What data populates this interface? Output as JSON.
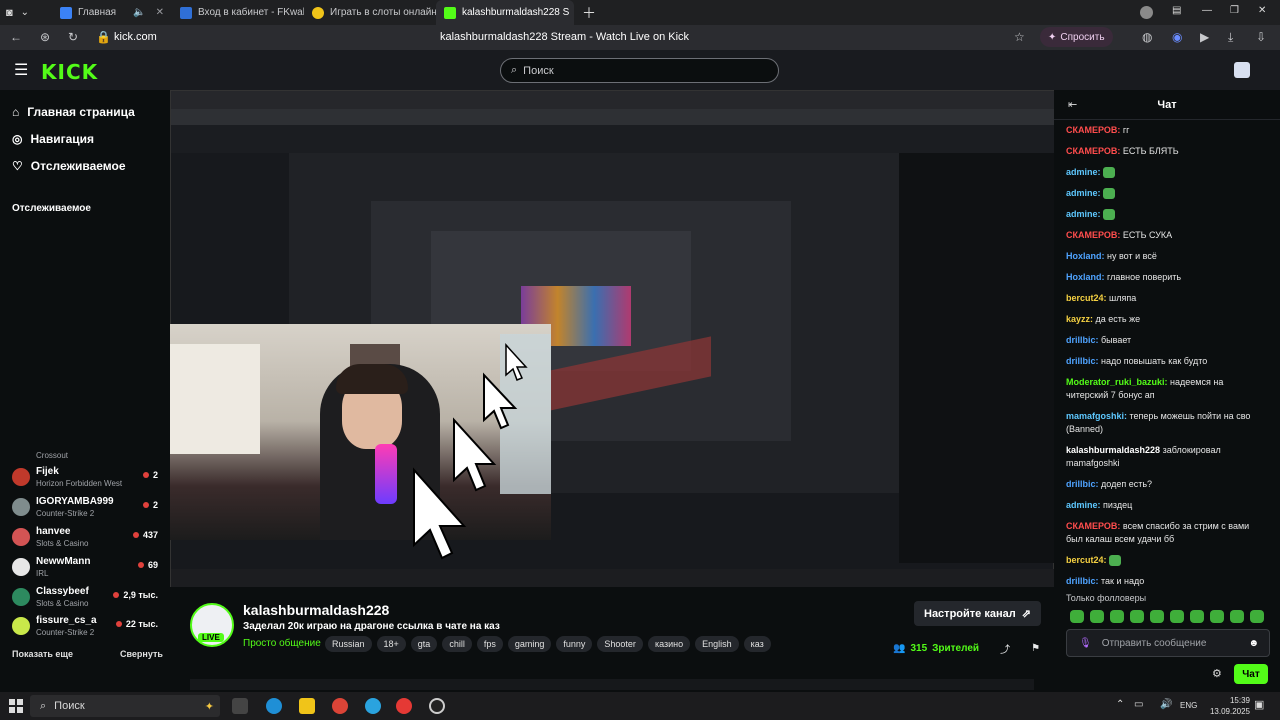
{
  "browser": {
    "tabs": [
      {
        "label": "Главная",
        "color": "#3b82f6"
      },
      {
        "label": "Вход в кабинет - FKwallet",
        "color": "#2f6fd6"
      },
      {
        "label": "Играть в слоты онлайн в",
        "color": "#f0c419"
      },
      {
        "label": "kalashburmaldash228 S",
        "color": "#53fc18"
      }
    ],
    "url": "kick.com",
    "page_title": "kalashburmaldash228 Stream - Watch Live on Kick",
    "ask_label": "Спросить"
  },
  "header": {
    "logo": "KICK",
    "search_placeholder": "Поиск"
  },
  "sidebar": {
    "nav": [
      {
        "label": "Главная страница",
        "icon": "home-icon"
      },
      {
        "label": "Навигация",
        "icon": "compass-icon"
      },
      {
        "label": "Отслеживаемое",
        "icon": "heart-icon"
      }
    ],
    "section_title": "Отслеживаемое",
    "partial_game": "Crossout",
    "following": [
      {
        "name": "Fijek",
        "game": "Horizon Forbidden West",
        "count": "2",
        "color": "#c0392b"
      },
      {
        "name": "IGORYAMBA999",
        "game": "Counter-Strike 2",
        "count": "2",
        "color": "#7f8c8d"
      },
      {
        "name": "hanvee",
        "game": "Slots & Casino",
        "count": "437",
        "color": "#d35454"
      },
      {
        "name": "NewwMann",
        "game": "IRL",
        "count": "69",
        "color": "#e7e7e7"
      },
      {
        "name": "Classybeef",
        "game": "Slots & Casino",
        "count": "2,9 тыс.",
        "color": "#2d8a5f"
      },
      {
        "name": "fissure_cs_a",
        "game": "Counter-Strike 2",
        "count": "22 тыс.",
        "color": "#c9e84a"
      }
    ],
    "show_more": "Показать еще",
    "collapse": "Свернуть"
  },
  "stream": {
    "streamer": "kalashburmaldash228",
    "live_badge": "LIVE",
    "title": "Заделал 20к играю на драгоне ссылка в чате на каз",
    "category": "Просто общение",
    "tags": [
      "Russian",
      "18+",
      "gta",
      "chill",
      "fps",
      "gaming",
      "funny",
      "Shooter",
      "казино",
      "English",
      "каз"
    ],
    "setup_button": "Настройте канал",
    "viewer_count": "315",
    "viewers_label": "Зрителей"
  },
  "chat": {
    "title": "Чат",
    "messages": [
      {
        "user": "СКАМЕРОВ:",
        "text": "гг",
        "color": "#ff4d4d"
      },
      {
        "user": "СКАМЕРОВ:",
        "text": "ЕСТЬ БЛЯТЬ",
        "color": "#ff4d4d"
      },
      {
        "user": "admine:",
        "text": "",
        "color": "#5ec8ff",
        "emote": true
      },
      {
        "user": "admine:",
        "text": "",
        "color": "#5ec8ff",
        "emote": true
      },
      {
        "user": "admine:",
        "text": "",
        "color": "#5ec8ff",
        "emote": true
      },
      {
        "user": "СКАМЕРОВ:",
        "text": "ЕСТЬ СУКА",
        "color": "#ff4d4d"
      },
      {
        "user": "Hoxland:",
        "text": "ну вот и всё",
        "color": "#4fa3ff"
      },
      {
        "user": "Hoxland:",
        "text": "главное поверить",
        "color": "#4fa3ff"
      },
      {
        "user": "bercut24:",
        "text": "шляпа",
        "color": "#f5d142"
      },
      {
        "user": "kayzz:",
        "text": "да есть же",
        "color": "#f5d142"
      },
      {
        "user": "drillbic:",
        "text": "бывает",
        "color": "#4fa3ff"
      },
      {
        "user": "drillbic:",
        "text": "надо повышать как будто",
        "color": "#4fa3ff"
      },
      {
        "user": "Moderator_ruki_bazuki:",
        "text": "надеемся на читерский 7 бонус ап",
        "color": "#53fc18"
      },
      {
        "user": "mamafgoshki:",
        "text": "теперь можешь пойти на сво (Banned)",
        "color": "#5ec8ff"
      },
      {
        "user": "kalashburmaldash228",
        "text": "заблокировал mamafgoshki",
        "color": "#ffffff"
      },
      {
        "user": "drillbic:",
        "text": "додеп есть?",
        "color": "#4fa3ff"
      },
      {
        "user": "admine:",
        "text": "пиздец",
        "color": "#5ec8ff"
      },
      {
        "user": "СКАМЕРОВ:",
        "text": "всем спасибо за стрим с вами был калаш всем удачи бб",
        "color": "#ff4d4d"
      },
      {
        "user": "bercut24:",
        "text": "",
        "color": "#f5d142",
        "emote": true
      },
      {
        "user": "drillbic:",
        "text": "так и надо",
        "color": "#4fa3ff"
      }
    ],
    "followers_only": "Только фолловеры",
    "input_placeholder": "Отправить сообщение",
    "send_label": "Чат"
  },
  "taskbar": {
    "search": "Поиск",
    "lang": "ENG",
    "time": "15:39",
    "date": "13.09.2025"
  }
}
